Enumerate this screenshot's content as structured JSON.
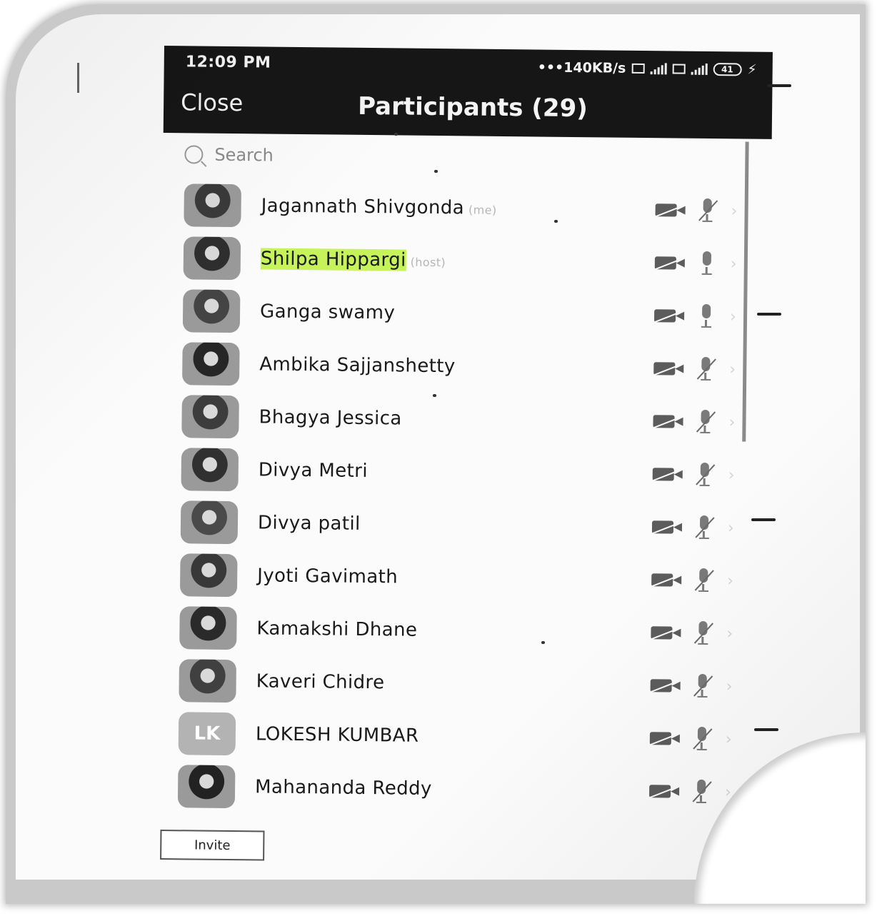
{
  "status_bar": {
    "time": "12:09 PM",
    "network_speed": "•••140KB/s",
    "battery": "41"
  },
  "header": {
    "close_label": "Close",
    "title": "Participants (29)"
  },
  "search": {
    "placeholder": "Search"
  },
  "participants": [
    {
      "name": "Jagannath Shivgonda",
      "role": "(me)",
      "avatar": "photo",
      "video": "off",
      "audio": "muted"
    },
    {
      "name": "Shilpa Hippargi",
      "role": "(host)",
      "avatar": "photo",
      "video": "off",
      "audio": "unmuted",
      "highlighted": true
    },
    {
      "name": "Ganga swamy",
      "role": "",
      "avatar": "photo",
      "video": "off",
      "audio": "unmuted"
    },
    {
      "name": "Ambika Sajjanshetty",
      "role": "",
      "avatar": "photo",
      "video": "off",
      "audio": "muted"
    },
    {
      "name": "Bhagya Jessica",
      "role": "",
      "avatar": "photo",
      "video": "off",
      "audio": "muted"
    },
    {
      "name": "Divya Metri",
      "role": "",
      "avatar": "photo",
      "video": "off",
      "audio": "muted"
    },
    {
      "name": "Divya patil",
      "role": "",
      "avatar": "photo",
      "video": "off",
      "audio": "muted"
    },
    {
      "name": "Jyoti Gavimath",
      "role": "",
      "avatar": "photo",
      "video": "off",
      "audio": "muted"
    },
    {
      "name": "Kamakshi Dhane",
      "role": "",
      "avatar": "photo",
      "video": "off",
      "audio": "muted"
    },
    {
      "name": "Kaveri Chidre",
      "role": "",
      "avatar": "photo",
      "video": "off",
      "audio": "muted"
    },
    {
      "name": "LOKESH KUMBAR",
      "role": "",
      "avatar": "LK",
      "video": "off",
      "audio": "muted"
    },
    {
      "name": "Mahananda Reddy",
      "role": "",
      "avatar": "photo",
      "video": "off",
      "audio": "muted"
    }
  ],
  "footer": {
    "invite_label": "Invite"
  },
  "colors": {
    "header_bg": "#161616",
    "highlight": "#c6f25a",
    "initials_avatar": "#b3b3b3"
  }
}
